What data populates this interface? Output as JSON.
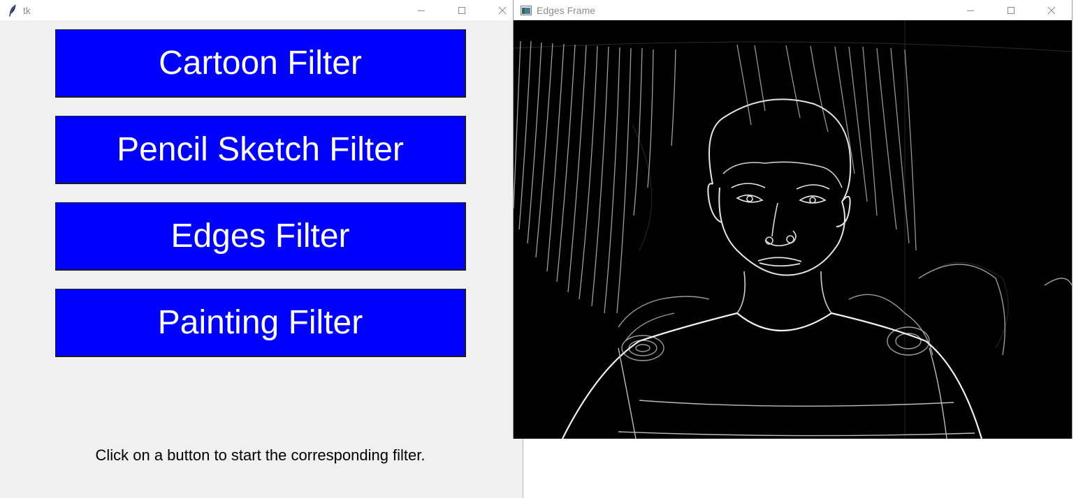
{
  "tk_window": {
    "title": "tk",
    "icon": "feather-icon",
    "buttons": [
      {
        "label": "Cartoon Filter"
      },
      {
        "label": "Pencil Sketch Filter"
      },
      {
        "label": "Edges Filter"
      },
      {
        "label": "Painting Filter"
      }
    ],
    "button_color": "#0000ff",
    "button_text_color": "#ffffff",
    "status": "Click on a button to start the corresponding filter."
  },
  "edges_window": {
    "title": "Edges Frame",
    "icon": "app-window-icon",
    "image": "edge-detected-webcam-frame"
  },
  "caption_icons": [
    "minimize-icon",
    "maximize-icon",
    "close-icon"
  ]
}
